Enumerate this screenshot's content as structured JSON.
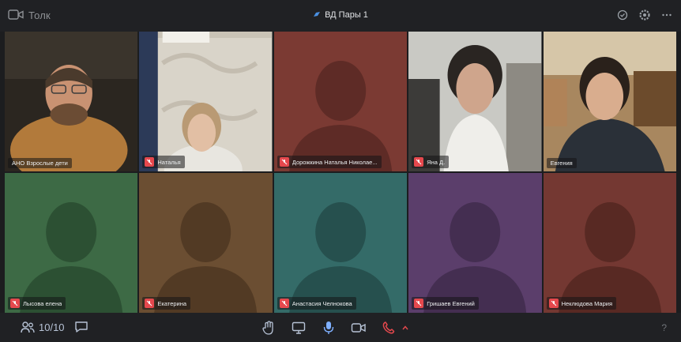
{
  "app": {
    "name": "Толк"
  },
  "meeting": {
    "title": "ВД Пары 1"
  },
  "colors": {
    "accent": "#3d8af7",
    "mute_red": "#e5484d",
    "end_call_red": "#e5484d"
  },
  "icons": {
    "top_left": "camera-logo-icon",
    "title": "meeting-icon",
    "top_right": [
      "shield-icon",
      "gear-icon",
      "more-icon"
    ],
    "bottom": [
      "participants-icon",
      "chat-icon",
      "raise-hand-icon",
      "screen-share-icon",
      "microphone-icon",
      "camera-icon",
      "end-call-icon",
      "chevron-up-icon"
    ]
  },
  "participants": [
    {
      "name": "АНО Взрослые дети",
      "muted": false,
      "video": true,
      "active": true
    },
    {
      "name": "Наталья",
      "muted": true,
      "video": true,
      "active": false
    },
    {
      "name": "Дорожкина Наталья Николае...",
      "muted": true,
      "video": false,
      "bg": "#7b3a33",
      "silhouette": "#5e2b26"
    },
    {
      "name": "Яна Д.",
      "muted": true,
      "video": true
    },
    {
      "name": "Евгения",
      "muted": false,
      "video": true
    },
    {
      "name": "Лысова елена",
      "muted": true,
      "video": false,
      "bg": "#3d6a45",
      "silhouette": "#2c5033"
    },
    {
      "name": "Екатерина",
      "muted": true,
      "video": false,
      "bg": "#6b4e32",
      "silhouette": "#523a24"
    },
    {
      "name": "Анастасия Челнокова",
      "muted": true,
      "video": false,
      "bg": "#346b68",
      "silhouette": "#26504e"
    },
    {
      "name": "Гришаев Евгений",
      "muted": true,
      "video": false,
      "bg": "#5b3e6b",
      "silhouette": "#442e51"
    },
    {
      "name": "Неклюдова Мария",
      "muted": true,
      "video": false,
      "bg": "#743832",
      "silhouette": "#582923"
    }
  ],
  "bottom": {
    "participants_count": "10/10",
    "help": "?"
  }
}
